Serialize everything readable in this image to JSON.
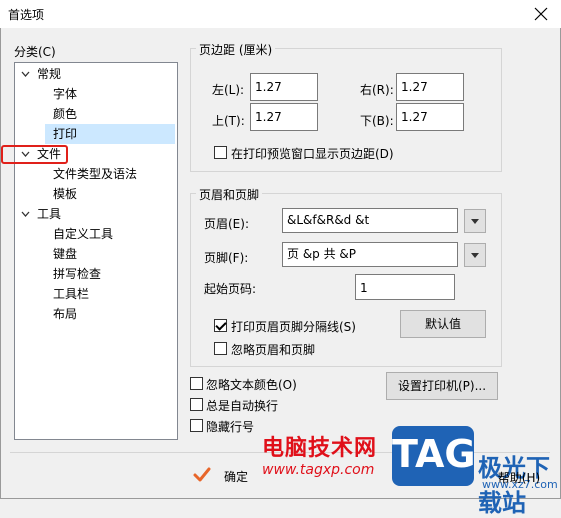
{
  "window": {
    "title": "首选项"
  },
  "category": {
    "label": "分类(C)",
    "items": [
      {
        "label": "常规",
        "level": 0,
        "expanded": true
      },
      {
        "label": "字体",
        "level": 1
      },
      {
        "label": "颜色",
        "level": 1
      },
      {
        "label": "打印",
        "level": 1,
        "selected": true
      },
      {
        "label": "文件",
        "level": 0,
        "expanded": true
      },
      {
        "label": "文件类型及语法",
        "level": 1
      },
      {
        "label": "模板",
        "level": 1
      },
      {
        "label": "工具",
        "level": 0,
        "expanded": true
      },
      {
        "label": "自定义工具",
        "level": 1
      },
      {
        "label": "键盘",
        "level": 1
      },
      {
        "label": "拼写检查",
        "level": 1
      },
      {
        "label": "工具栏",
        "level": 1
      },
      {
        "label": "布局",
        "level": 1
      }
    ]
  },
  "margins": {
    "title": "页边距 (厘米)",
    "left_label": "左(L):",
    "left_value": "1.27",
    "right_label": "右(R):",
    "right_value": "1.27",
    "top_label": "上(T):",
    "top_value": "1.27",
    "bottom_label": "下(B):",
    "bottom_value": "1.27",
    "show_in_preview_label": "在打印预览窗口显示页边距(D)",
    "show_in_preview_checked": false
  },
  "header_footer": {
    "title": "页眉和页脚",
    "header_label": "页眉(E):",
    "header_value": "&L&f&R&d &t",
    "footer_label": "页脚(F):",
    "footer_value": "页 &p 共 &P",
    "start_page_label": "起始页码:",
    "start_page_value": "1",
    "print_separator_label": "打印页眉页脚分隔线(S)",
    "print_separator_checked": true,
    "ignore_label": "忽略页眉和页脚",
    "ignore_checked": false,
    "default_button": "默认值"
  },
  "options": {
    "ignore_text_color_label": "忽略文本颜色(O)",
    "ignore_text_color_checked": false,
    "word_wrap_label": "总是自动换行",
    "word_wrap_checked": false,
    "hide_line_numbers_label": "隐藏行号",
    "hide_line_numbers_checked": false,
    "setup_printer_button": "设置打印机(P)..."
  },
  "footer": {
    "ok_button": "确定",
    "help_button": "帮助(H)"
  },
  "watermark": {
    "site_name": "电脑技术网",
    "site_url": "www.tagxp.com",
    "tag_text": "TAG",
    "brand_cn": "极光下载站",
    "brand_url": "www.xz7.com"
  },
  "colors": {
    "selection": "#cce8ff",
    "highlight_box": "#e0201a",
    "watermark_red": "#e0101a",
    "watermark_blue": "#1f63b5"
  }
}
